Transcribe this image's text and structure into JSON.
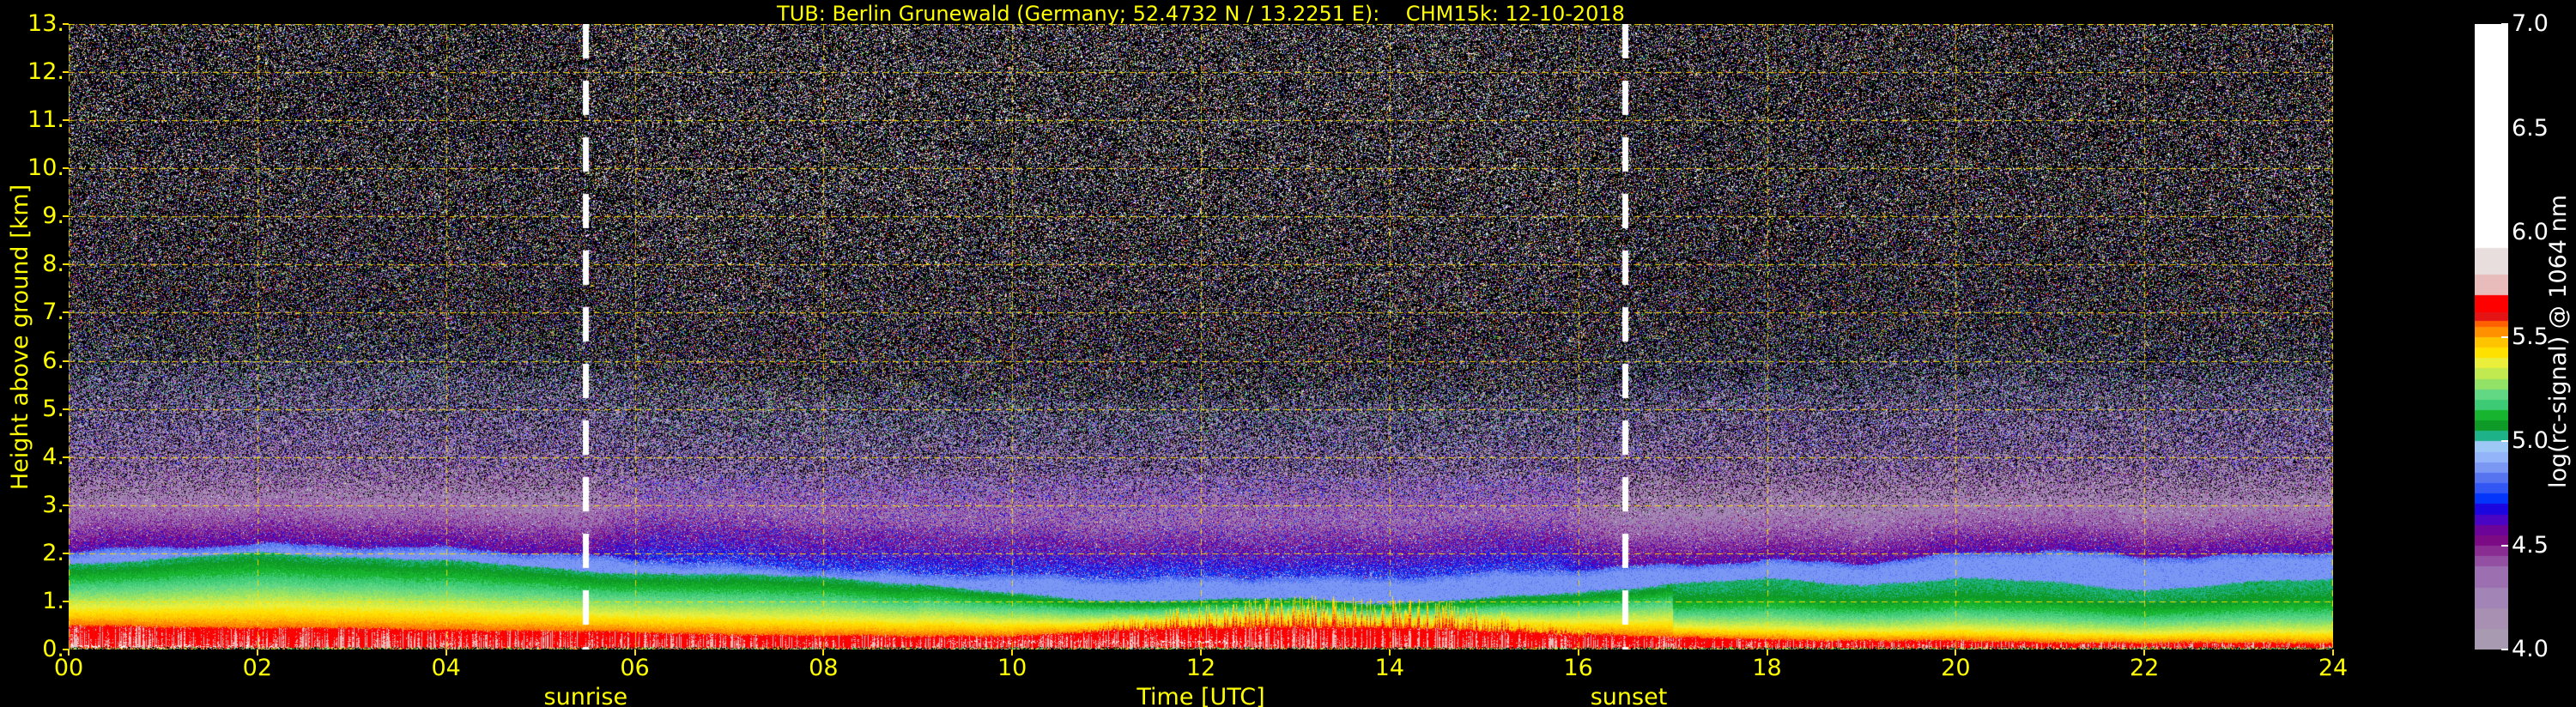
{
  "window": {
    "background": "#000000"
  },
  "chart_data": {
    "type": "heatmap",
    "title": "TUB: Berlin Grunewald (Germany; 52.4732 N / 13.2251 E):    CHM15k: 12-10-2018",
    "station": "TUB: Berlin Grunewald",
    "country": "Germany",
    "latitude": "52.4732 N",
    "longitude": "13.2251 E",
    "instrument": "CHM15k",
    "date": "12-10-2018",
    "xlabel": "Time [UTC]",
    "ylabel": "Height above ground [km]",
    "colorbar_label": "log(rc-signal) @ 1064 nm",
    "x_range_hours": [
      0,
      24
    ],
    "y_range_km": [
      0,
      13
    ],
    "colorbar_range": [
      4.0,
      7.0
    ],
    "x_tick_labels": [
      "00",
      "02",
      "04",
      "06",
      "08",
      "10",
      "12",
      "14",
      "16",
      "18",
      "20",
      "22",
      "24"
    ],
    "y_tick_labels": [
      "0.",
      "1.",
      "2.",
      "3.",
      "4.",
      "5.",
      "6.",
      "7.",
      "8.",
      "9.",
      "10.",
      "11.",
      "12.",
      "13."
    ],
    "colorbar_tick_labels": [
      "4.0",
      "4.5",
      "5.0",
      "5.5",
      "6.0",
      "6.5",
      "7.0"
    ],
    "grid": {
      "on": true,
      "color": "#ffe000",
      "x_step_hours": 2,
      "y_step_km": 1,
      "style": "dashed"
    },
    "sunrise": {
      "label": "sunrise",
      "hour": 5.48
    },
    "sunset": {
      "label": "sunset",
      "hour": 16.49
    },
    "marker_line": {
      "color": "#ffffff",
      "style": "dashed"
    },
    "text_color_axes": "#ffff00",
    "text_color_colorbar": "#ffffff",
    "colormap_bands": [
      [
        4.0,
        "#a89ab0"
      ],
      [
        4.1,
        "#a790b2"
      ],
      [
        4.2,
        "#a285b6"
      ],
      [
        4.3,
        "#9c70b0"
      ],
      [
        4.4,
        "#9350a2"
      ],
      [
        4.45,
        "#8a2d92"
      ],
      [
        4.5,
        "#7c0a84"
      ],
      [
        4.55,
        "#6c0499"
      ],
      [
        4.6,
        "#4a04c4"
      ],
      [
        4.65,
        "#1c06e0"
      ],
      [
        4.7,
        "#0336fa"
      ],
      [
        4.75,
        "#3156f4"
      ],
      [
        4.8,
        "#5673f0"
      ],
      [
        4.85,
        "#7b97f4"
      ],
      [
        4.9,
        "#93b4f8"
      ],
      [
        4.95,
        "#9ec9f6"
      ],
      [
        5.0,
        "#1eb288"
      ],
      [
        5.05,
        "#0e9a26"
      ],
      [
        5.1,
        "#17b42f"
      ],
      [
        5.15,
        "#3ccb74"
      ],
      [
        5.2,
        "#63d884"
      ],
      [
        5.25,
        "#91e267"
      ],
      [
        5.3,
        "#c1ea50"
      ],
      [
        5.35,
        "#e9ef3a"
      ],
      [
        5.4,
        "#ffe100"
      ],
      [
        5.45,
        "#ffc400"
      ],
      [
        5.5,
        "#ff9000"
      ],
      [
        5.55,
        "#ff6000"
      ],
      [
        5.58,
        "#e41414"
      ],
      [
        5.62,
        "#ff0000"
      ],
      [
        5.7,
        "#e9bcbc"
      ],
      [
        5.8,
        "#e9dede"
      ],
      [
        5.93,
        "#ffffff"
      ]
    ],
    "boundary_layers": {
      "hours": [
        0,
        1,
        2,
        3,
        4,
        5,
        6,
        7,
        8,
        9,
        10,
        11,
        12,
        13,
        14,
        15,
        16,
        17,
        18,
        19,
        20,
        21,
        22,
        23,
        24
      ],
      "red_top_km": [
        0.5,
        0.48,
        0.46,
        0.44,
        0.42,
        0.4,
        0.36,
        0.33,
        0.3,
        0.28,
        0.3,
        0.38,
        0.45,
        0.48,
        0.45,
        0.4,
        0.33,
        0.26,
        0.22,
        0.2,
        0.18,
        0.16,
        0.15,
        0.14,
        0.14
      ],
      "green_top_km": [
        1.75,
        1.85,
        2.0,
        1.95,
        1.88,
        1.75,
        1.62,
        1.55,
        1.5,
        1.32,
        1.12,
        1.02,
        1.05,
        1.1,
        1.02,
        1.08,
        1.18,
        1.35,
        1.42,
        1.32,
        1.48,
        1.42,
        1.28,
        1.42,
        1.48
      ],
      "blue_top_km": [
        2.0,
        2.1,
        2.25,
        2.2,
        2.1,
        1.95,
        1.85,
        1.8,
        1.72,
        1.58,
        1.5,
        1.45,
        1.52,
        1.58,
        1.5,
        1.55,
        1.62,
        1.78,
        1.92,
        1.82,
        1.95,
        2.02,
        1.92,
        2.02,
        2.08
      ]
    },
    "convective_plume_window_hours": [
      10.3,
      16.6
    ],
    "noise_seed": 12102018
  }
}
